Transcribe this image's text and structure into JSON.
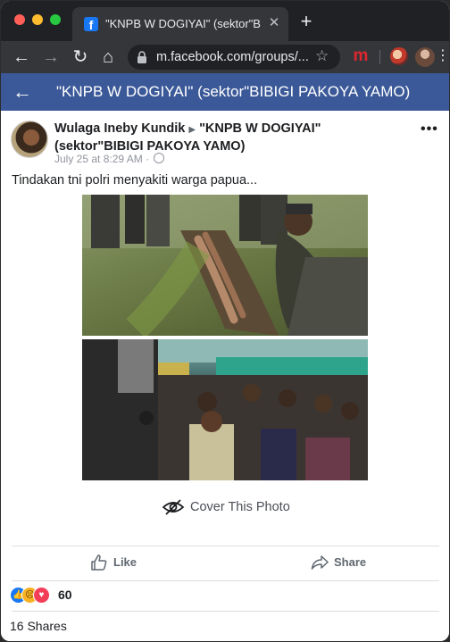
{
  "browser": {
    "tab_title": "\"KNPB W DOGIYAI\" (sektor\"BIBIGI PAKOYA YAMO\")",
    "url": "m.facebook.com/groups/...",
    "tab_favicon": "facebook-icon",
    "extension_letter": "m",
    "accent_colors": {
      "close": "#ff5f57",
      "minimize": "#febc2e",
      "zoom": "#28c840"
    }
  },
  "fb_header": {
    "group_title": "\"KNPB W DOGIYAI\" (sektor\"BIBIGI PAKOYA YAMO)",
    "background": "#3b5998"
  },
  "post": {
    "author": "Wulaga Ineby Kundik",
    "group": "\"KNPB W DOGIYAI\" (sektor\"BIBIGI PAKOYA YAMO)",
    "timestamp": "July 25 at 8:29 AM",
    "privacy_separator": "·",
    "text": "Tindakan tni polri menyakiti warga papua...",
    "cover_label": "Cover This Photo",
    "like_label": "Like",
    "share_label": "Share",
    "reaction_count": "60",
    "reactions": [
      "like",
      "sad",
      "love"
    ],
    "shares_text": "16 Shares"
  }
}
